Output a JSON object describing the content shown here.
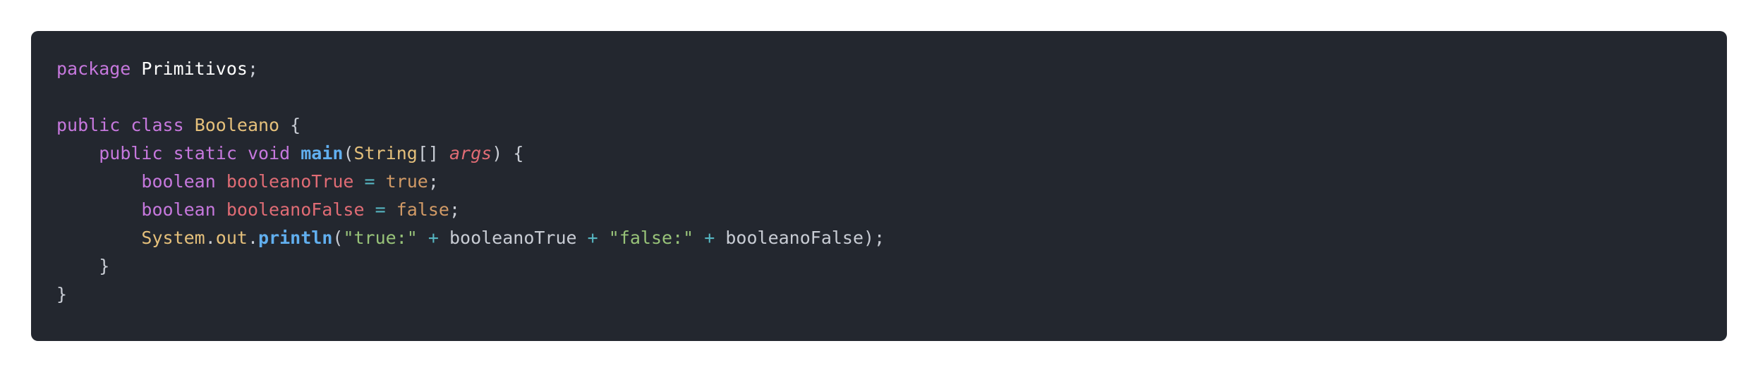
{
  "colors": {
    "page_bg": "#ffffff",
    "editor_bg": "#23272f",
    "keyword": "#c678dd",
    "plain": "#c8ccd4",
    "package_name": "#ffffff",
    "class_name": "#e5c07b",
    "method": "#61afef",
    "param": "#e06c75",
    "string": "#98c379",
    "operator": "#56b6c2",
    "boolean": "#d19a66",
    "variable": "#e06c75"
  },
  "code": {
    "language": "java",
    "lines": [
      [
        {
          "text": "package",
          "color": "#c678dd"
        },
        {
          "text": " ",
          "color": "#c8ccd4"
        },
        {
          "text": "Primitivos",
          "color": "#ffffff"
        },
        {
          "text": ";",
          "color": "#c8ccd4"
        }
      ],
      [],
      [
        {
          "text": "public",
          "color": "#c678dd"
        },
        {
          "text": " ",
          "color": "#c8ccd4"
        },
        {
          "text": "class",
          "color": "#c678dd"
        },
        {
          "text": " ",
          "color": "#c8ccd4"
        },
        {
          "text": "Booleano",
          "color": "#e5c07b"
        },
        {
          "text": " {",
          "color": "#c8ccd4"
        }
      ],
      [
        {
          "text": "    ",
          "color": "#c8ccd4"
        },
        {
          "text": "public",
          "color": "#c678dd"
        },
        {
          "text": " ",
          "color": "#c8ccd4"
        },
        {
          "text": "static",
          "color": "#c678dd"
        },
        {
          "text": " ",
          "color": "#c8ccd4"
        },
        {
          "text": "void",
          "color": "#c678dd"
        },
        {
          "text": " ",
          "color": "#c8ccd4"
        },
        {
          "text": "main",
          "color": "#61afef",
          "bold": true
        },
        {
          "text": "(",
          "color": "#c8ccd4"
        },
        {
          "text": "String",
          "color": "#e5c07b"
        },
        {
          "text": "[] ",
          "color": "#c8ccd4"
        },
        {
          "text": "args",
          "color": "#e06c75",
          "italic": true
        },
        {
          "text": ") {",
          "color": "#c8ccd4"
        }
      ],
      [
        {
          "text": "        ",
          "color": "#c8ccd4"
        },
        {
          "text": "boolean",
          "color": "#c678dd"
        },
        {
          "text": " ",
          "color": "#c8ccd4"
        },
        {
          "text": "booleanoTrue",
          "color": "#e06c75"
        },
        {
          "text": " ",
          "color": "#c8ccd4"
        },
        {
          "text": "=",
          "color": "#56b6c2"
        },
        {
          "text": " ",
          "color": "#c8ccd4"
        },
        {
          "text": "true",
          "color": "#d19a66"
        },
        {
          "text": ";",
          "color": "#c8ccd4"
        }
      ],
      [
        {
          "text": "        ",
          "color": "#c8ccd4"
        },
        {
          "text": "boolean",
          "color": "#c678dd"
        },
        {
          "text": " ",
          "color": "#c8ccd4"
        },
        {
          "text": "booleanoFalse",
          "color": "#e06c75"
        },
        {
          "text": " ",
          "color": "#c8ccd4"
        },
        {
          "text": "=",
          "color": "#56b6c2"
        },
        {
          "text": " ",
          "color": "#c8ccd4"
        },
        {
          "text": "false",
          "color": "#d19a66"
        },
        {
          "text": ";",
          "color": "#c8ccd4"
        }
      ],
      [
        {
          "text": "        ",
          "color": "#c8ccd4"
        },
        {
          "text": "System",
          "color": "#e5c07b"
        },
        {
          "text": ".",
          "color": "#c8ccd4"
        },
        {
          "text": "out",
          "color": "#e5c07b"
        },
        {
          "text": ".",
          "color": "#c8ccd4"
        },
        {
          "text": "println",
          "color": "#61afef",
          "bold": true
        },
        {
          "text": "(",
          "color": "#c8ccd4"
        },
        {
          "text": "\"true:\"",
          "color": "#98c379"
        },
        {
          "text": " ",
          "color": "#c8ccd4"
        },
        {
          "text": "+",
          "color": "#56b6c2"
        },
        {
          "text": " booleanoTrue ",
          "color": "#c8ccd4"
        },
        {
          "text": "+",
          "color": "#56b6c2"
        },
        {
          "text": " ",
          "color": "#c8ccd4"
        },
        {
          "text": "\"false:\"",
          "color": "#98c379"
        },
        {
          "text": " ",
          "color": "#c8ccd4"
        },
        {
          "text": "+",
          "color": "#56b6c2"
        },
        {
          "text": " booleanoFalse);",
          "color": "#c8ccd4"
        }
      ],
      [
        {
          "text": "    }",
          "color": "#c8ccd4"
        }
      ],
      [
        {
          "text": "}",
          "color": "#c8ccd4"
        }
      ]
    ]
  }
}
